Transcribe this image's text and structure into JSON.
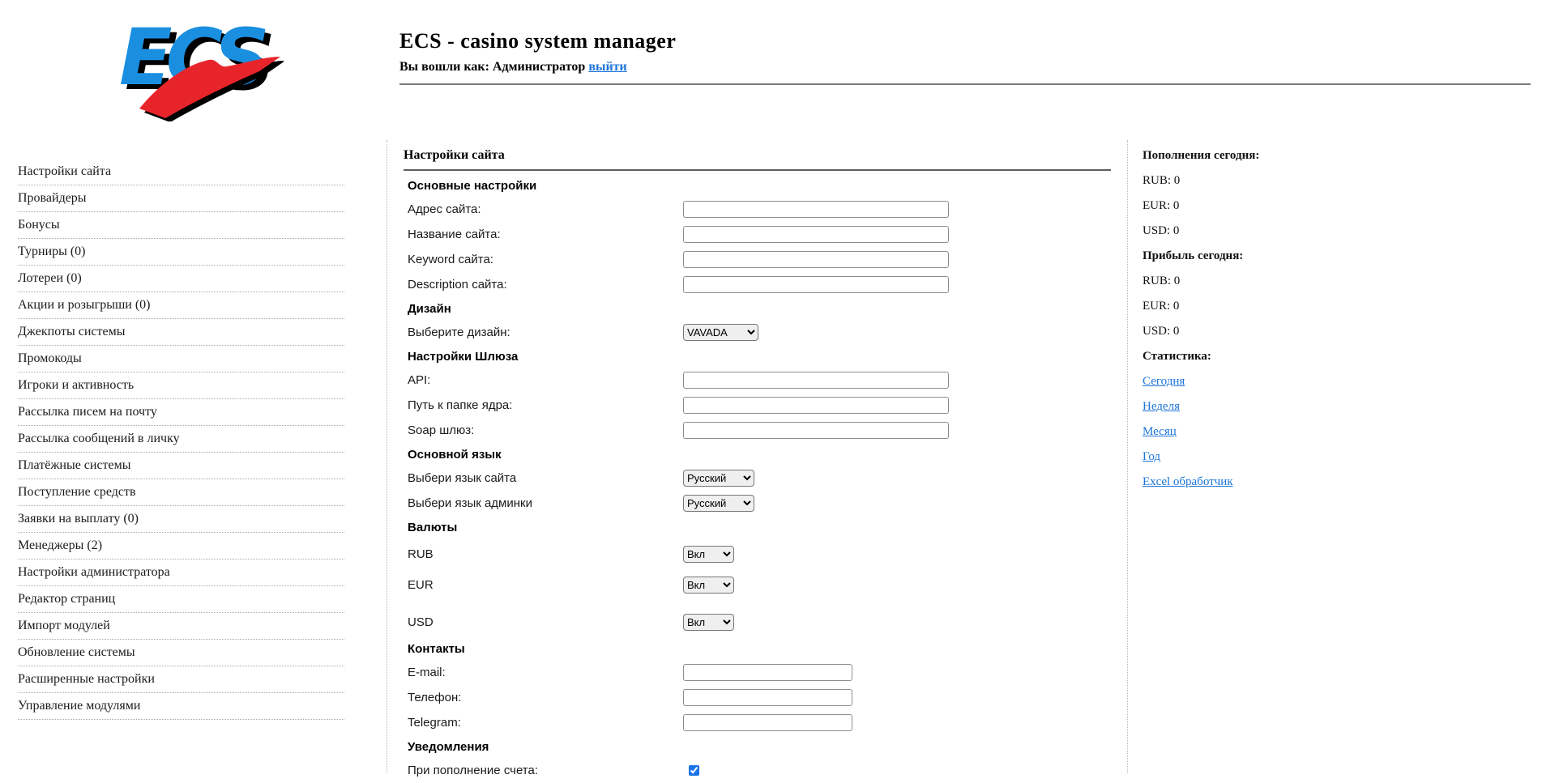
{
  "colors": {
    "link_blue": "#1b73d8",
    "logo_blue": "#1a8fe0",
    "logo_red": "#e8242b",
    "checkbox_blue": "#1a73e8",
    "rule_dark": "#5e5e5e",
    "rule_gray": "#7a7a7a"
  },
  "header": {
    "logo_text": "ECS",
    "title": "ECS - casino system manager",
    "login_prefix": "Вы вошли как: Администратор",
    "logout_label": "выйти"
  },
  "sidebar": {
    "items": [
      {
        "label": "Настройки сайта"
      },
      {
        "label": "Провайдеры"
      },
      {
        "label": "Бонусы"
      },
      {
        "label": "Турниры (0)"
      },
      {
        "label": "Лотереи (0)"
      },
      {
        "label": "Акции и розыгрыши (0)"
      },
      {
        "label": "Джекпоты системы"
      },
      {
        "label": "Промокоды"
      },
      {
        "label": "Игроки и активность"
      },
      {
        "label": "Рассылка писем на почту"
      },
      {
        "label": "Рассылка сообщений в личку"
      },
      {
        "label": "Платёжные системы"
      },
      {
        "label": "Поступление средств"
      },
      {
        "label": "Заявки на выплату (0)"
      },
      {
        "label": "Менеджеры (2)"
      },
      {
        "label": "Настройки администратора"
      },
      {
        "label": "Редактор страниц"
      },
      {
        "label": "Импорт модулей"
      },
      {
        "label": "Обновление системы"
      },
      {
        "label": "Расширенные настройки"
      },
      {
        "label": "Управление модулями"
      }
    ]
  },
  "main": {
    "title": "Настройки сайта",
    "rows": [
      {
        "type": "section",
        "label": "Основные настройки"
      },
      {
        "type": "text",
        "label": "Адрес сайта:",
        "value": "",
        "variant": "wide"
      },
      {
        "type": "text",
        "label": "Название сайта:",
        "value": "",
        "variant": "wide"
      },
      {
        "type": "text",
        "label": "Keyword сайта:",
        "value": "",
        "variant": "wide"
      },
      {
        "type": "text",
        "label": "Description сайта:",
        "value": "",
        "variant": "wide"
      },
      {
        "type": "section",
        "label": "Дизайн"
      },
      {
        "type": "select",
        "label": "Выберите дизайн:",
        "value": "VAVADA",
        "variant": "design"
      },
      {
        "type": "section",
        "label": "Настройки Шлюза"
      },
      {
        "type": "text",
        "label": "API:",
        "value": "",
        "variant": "wide"
      },
      {
        "type": "text",
        "label": "Путь к папке ядра:",
        "value": "",
        "variant": "wide"
      },
      {
        "type": "text",
        "label": "Soap шлюз:",
        "value": "",
        "variant": "wide"
      },
      {
        "type": "section",
        "label": "Основной язык"
      },
      {
        "type": "select",
        "label": "Выбери язык сайта",
        "value": "Русский",
        "variant": "lang"
      },
      {
        "type": "select",
        "label": "Выбери язык админки",
        "value": "Русский",
        "variant": "lang"
      },
      {
        "type": "section",
        "label": "Валюты"
      },
      {
        "type": "select",
        "label": "RUB",
        "value": "Вкл",
        "variant": "toggle",
        "tall": true
      },
      {
        "type": "select",
        "label": "EUR",
        "value": "Вкл",
        "variant": "toggle",
        "tall": true
      },
      {
        "type": "select",
        "label": "USD",
        "value": "Вкл",
        "variant": "toggle",
        "tall": true,
        "gap_before": true
      },
      {
        "type": "section",
        "label": "Контакты"
      },
      {
        "type": "text",
        "label": "E-mail:",
        "value": "",
        "variant": "short"
      },
      {
        "type": "text",
        "label": "Телефон:",
        "value": "",
        "variant": "short"
      },
      {
        "type": "text",
        "label": "Telegram:",
        "value": "",
        "variant": "short"
      },
      {
        "type": "section",
        "label": "Уведомления"
      },
      {
        "type": "checkbox",
        "label": "При пополнение счета:",
        "checked": true
      }
    ]
  },
  "stats": {
    "items": [
      {
        "type": "header",
        "label": "Пополнения сегодня:"
      },
      {
        "type": "value",
        "label": "RUB: 0"
      },
      {
        "type": "value",
        "label": "EUR: 0"
      },
      {
        "type": "value",
        "label": "USD: 0"
      },
      {
        "type": "header",
        "label": "Прибыль сегодня:"
      },
      {
        "type": "value",
        "label": "RUB: 0"
      },
      {
        "type": "value",
        "label": "EUR: 0"
      },
      {
        "type": "value",
        "label": "USD: 0"
      },
      {
        "type": "header",
        "label": "Статистика:"
      },
      {
        "type": "link",
        "label": "Сегодня"
      },
      {
        "type": "link",
        "label": "Неделя"
      },
      {
        "type": "link",
        "label": "Месяц"
      },
      {
        "type": "link",
        "label": "Год"
      },
      {
        "type": "link",
        "label": "Excel обработчик"
      }
    ]
  }
}
